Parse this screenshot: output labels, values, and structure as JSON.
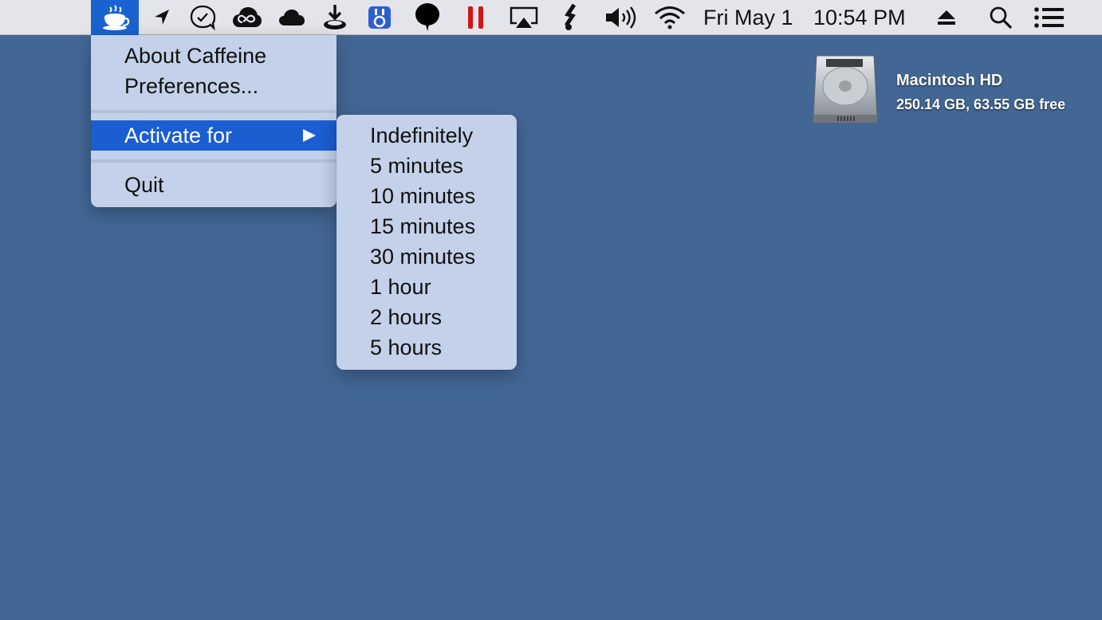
{
  "menubar": {
    "date": "Fri May 1",
    "time": "10:54 PM",
    "status_icons": [
      "caffeine-cup-icon",
      "location-arrow-icon",
      "chat-check-icon",
      "creative-cloud-icon",
      "cloud-icon",
      "download-disk-icon",
      "app-badge-icon",
      "balloon-icon",
      "pause-icon",
      "airplay-icon",
      "script-icon",
      "volume-icon",
      "wifi-icon",
      "eject-icon",
      "spotlight-search-icon",
      "notification-list-icon"
    ]
  },
  "caffeine_menu": {
    "about": "About Caffeine",
    "preferences": "Preferences...",
    "activate_for": "Activate for",
    "quit": "Quit"
  },
  "activate_submenu": {
    "items": [
      "Indefinitely",
      "5 minutes",
      "10 minutes",
      "15 minutes",
      "30 minutes",
      "1 hour",
      "2 hours",
      "5 hours"
    ]
  },
  "desktop": {
    "drive_name": "Macintosh HD",
    "drive_info": "250.14 GB, 63.55 GB free"
  },
  "colors": {
    "desktop_bg": "#436795",
    "menubar_bg": "#e3e5ea",
    "highlight": "#1a5ed1",
    "menu_bg": "#c7d5ec"
  }
}
